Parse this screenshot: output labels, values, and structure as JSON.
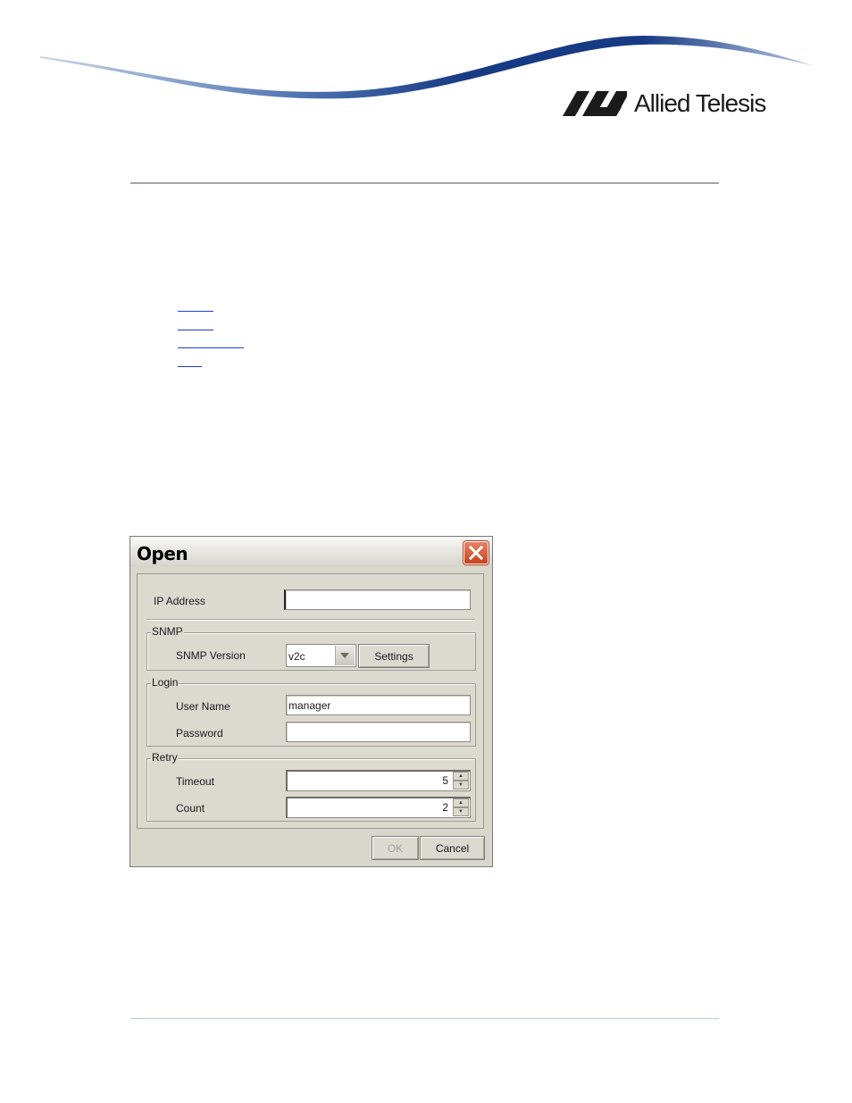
{
  "brand": {
    "logo_text": "Allied Telesis",
    "colors": {
      "swoosh_dark": "#173a84",
      "swoosh_light": "#8fb1d9",
      "rule_top": "#a8a49a",
      "link": "#1a3fd0"
    }
  },
  "dialog": {
    "title": "Open",
    "ip_address_label": "IP Address",
    "ip_address_value": "",
    "snmp_group": "SNMP",
    "snmp_version_label": "SNMP Version",
    "snmp_version_value": "v2c",
    "settings_button": "Settings",
    "login_group": "Login",
    "user_name_label": "User Name",
    "user_name_value": "manager",
    "password_label": "Password",
    "password_value": "",
    "retry_group": "Retry",
    "timeout_label": "Timeout",
    "timeout_value": "5",
    "count_label": "Count",
    "count_value": "2",
    "ok_button": "OK",
    "cancel_button": "Cancel"
  }
}
